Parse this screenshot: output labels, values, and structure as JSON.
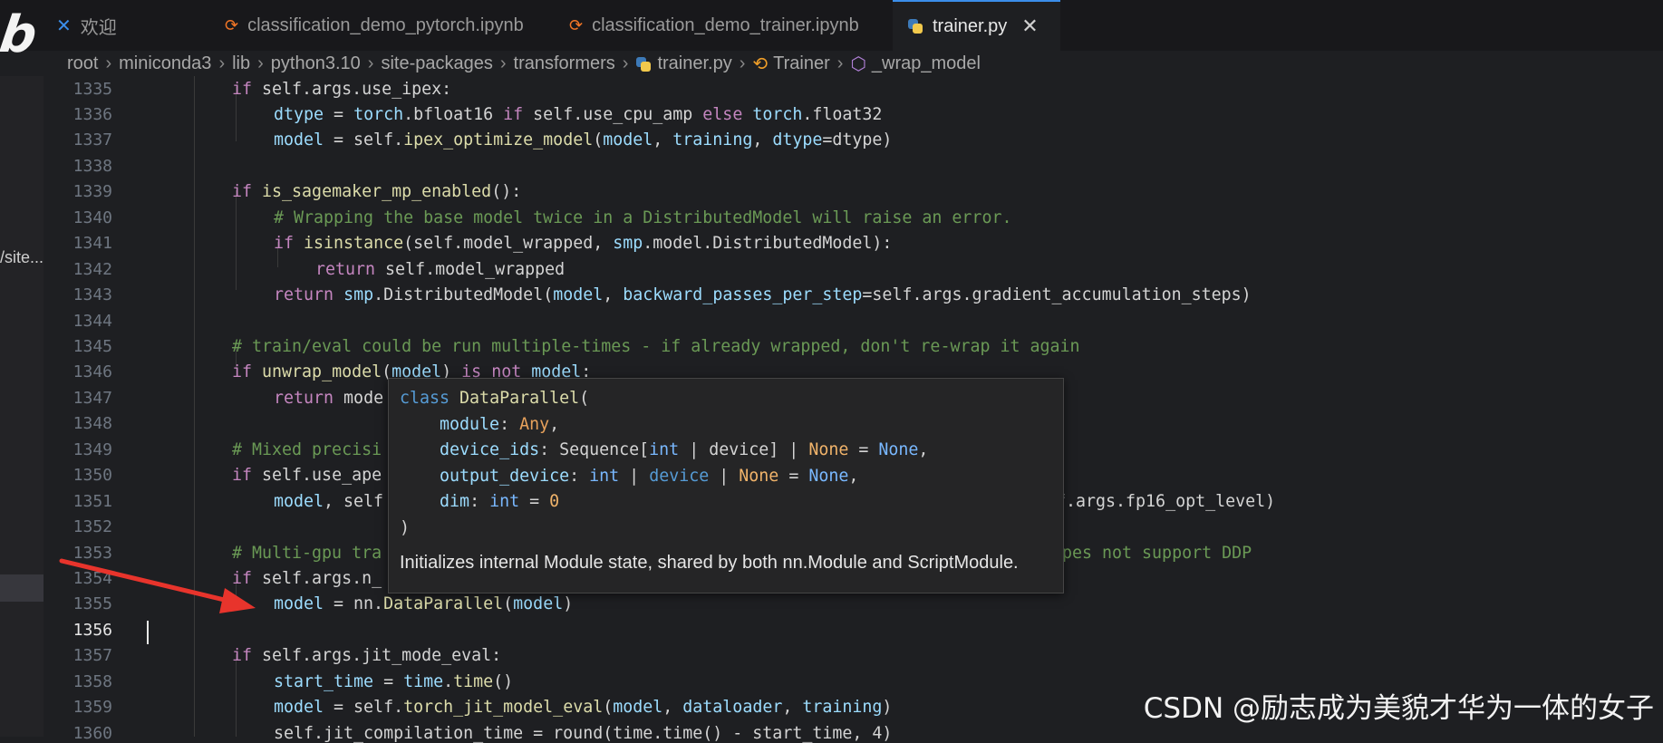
{
  "tabs": [
    {
      "label": "欢迎",
      "icon": "vscode-icon"
    },
    {
      "label": "classification_demo_pytorch.ipynb",
      "icon": "jupyter-icon"
    },
    {
      "label": "classification_demo_trainer.ipynb",
      "icon": "jupyter-icon"
    },
    {
      "label": "trainer.py",
      "icon": "python-icon",
      "active": true
    }
  ],
  "breadcrumb": {
    "items": [
      "root",
      "miniconda3",
      "lib",
      "python3.10",
      "site-packages",
      "transformers",
      "trainer.py",
      "Trainer",
      "_wrap_model"
    ]
  },
  "watermark_logo": "bilibili",
  "left_strip_label": "/site...",
  "line_numbers": [
    "1335",
    "1336",
    "1337",
    "1338",
    "1339",
    "1340",
    "1341",
    "1342",
    "1343",
    "1344",
    "1345",
    "1346",
    "1347",
    "1348",
    "1349",
    "1350",
    "1351",
    "1352",
    "1353",
    "1354",
    "1355",
    "1356",
    "1357",
    "1358",
    "1359",
    "1360"
  ],
  "current_line": "1356",
  "code": {
    "l1335": [
      "if",
      " self.args.use_ipex:"
    ],
    "l1336": [
      "dtype",
      " = ",
      "torch",
      ".bfloat16 ",
      "if",
      " self.use_cpu_amp ",
      "else",
      " ",
      "torch",
      ".float32"
    ],
    "l1337": [
      "model",
      " = self.",
      "ipex_optimize_model",
      "(",
      "model",
      ", ",
      "training",
      ", ",
      "dtype",
      "=dtype)"
    ],
    "l1339": [
      "if",
      " ",
      "is_sagemaker_mp_enabled",
      "():"
    ],
    "l1340": "# Wrapping the base model twice in a DistributedModel will raise an error.",
    "l1341": [
      "if",
      " ",
      "isinstance",
      "(self.model_wrapped, ",
      "smp",
      ".model.DistributedModel):"
    ],
    "l1342": [
      "return",
      " self.model_wrapped"
    ],
    "l1343": [
      "return",
      " ",
      "smp",
      ".DistributedModel(",
      "model",
      ", ",
      "backward_passes_per_step",
      "=self.args.gradient_accumulation_steps)"
    ],
    "l1345": "# train/eval could be run multiple-times - if already wrapped, don't re-wrap it again",
    "l1346": [
      "if",
      " ",
      "unwrap_model",
      "(",
      "model",
      ") ",
      "is",
      " ",
      "not",
      " ",
      "model",
      ":"
    ],
    "l1347": [
      "return",
      " mode"
    ],
    "l1349": "# Mixed precisi",
    "l1350": [
      "if",
      " self.use_ape"
    ],
    "l1351a": [
      "model",
      ", self"
    ],
    "l1351b": "f.args.fp16_opt_level)",
    "l1353a": "# Multi-gpu tra",
    "l1353b": "pes not support DDP",
    "l1354": [
      "if",
      " self.args.n_"
    ],
    "l1355": [
      "model",
      " = nn.",
      "DataParallel",
      "(",
      "model",
      ")"
    ],
    "l1357": [
      "if",
      " self.args.jit_mode_eval:"
    ],
    "l1358": [
      "start_time",
      " = ",
      "time",
      ".",
      "time",
      "()"
    ],
    "l1359": [
      "model",
      " = self.",
      "torch_jit_model_eval",
      "(",
      "model",
      ", ",
      "dataloader",
      ", ",
      "training",
      ")"
    ],
    "l1360": "self.jit_compilation_time = round(time.time() - start_time, 4)"
  },
  "hover": {
    "sig_lines": [
      [
        "class",
        " ",
        "DataParallel",
        "("
      ],
      [
        "    ",
        "module",
        ": ",
        "Any",
        ","
      ],
      [
        "    ",
        "device_ids",
        ": Sequence[",
        "int",
        " | ",
        "device",
        "] | ",
        "None",
        " = ",
        "None",
        ","
      ],
      [
        "    ",
        "output_device",
        ": ",
        "int",
        " | ",
        "device",
        " | ",
        "None",
        " = ",
        "None",
        ","
      ],
      [
        "    ",
        "dim",
        ": ",
        "int",
        " = ",
        "0"
      ],
      [
        ")"
      ]
    ],
    "doc": "Initializes internal Module state, shared by both nn.Module and ScriptModule."
  },
  "watermark": "CSDN @励志成为美貌才华为一体的女子",
  "colors": {
    "accent": "#3b8eea",
    "arrow": "#e8342c",
    "keyword": "#c586c0",
    "function": "#dcdcaa",
    "variable": "#9cdcfe",
    "comment": "#6a9955"
  }
}
